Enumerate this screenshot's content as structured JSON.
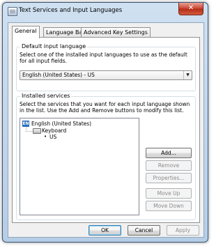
{
  "window": {
    "title": "Text Services and Input Languages",
    "close_symbol": "✕"
  },
  "tabs": [
    {
      "label": "General",
      "active": true
    },
    {
      "label": "Language Bar",
      "active": false
    },
    {
      "label": "Advanced Key Settings",
      "active": false
    }
  ],
  "default_language": {
    "group_label": "Default input language",
    "description": "Select one of the installed input languages to use as the default for all input fields.",
    "selected": "English (United States) - US"
  },
  "installed_services": {
    "group_label": "Installed services",
    "description": "Select the services that you want for each input language shown in the list. Use the Add and Remove buttons to modify this list.",
    "tree": {
      "language": "English (United States)",
      "language_code": "EN",
      "category": "Keyboard",
      "layout": "US"
    },
    "buttons": {
      "add": "Add...",
      "remove": "Remove",
      "properties": "Properties...",
      "move_up": "Move Up",
      "move_down": "Move Down"
    }
  },
  "footer": {
    "ok": "OK",
    "cancel": "Cancel",
    "apply": "Apply"
  },
  "colors": {
    "accent": "#2b6fbd",
    "window_frame": "#b6cde6",
    "close": "#c8432f"
  }
}
